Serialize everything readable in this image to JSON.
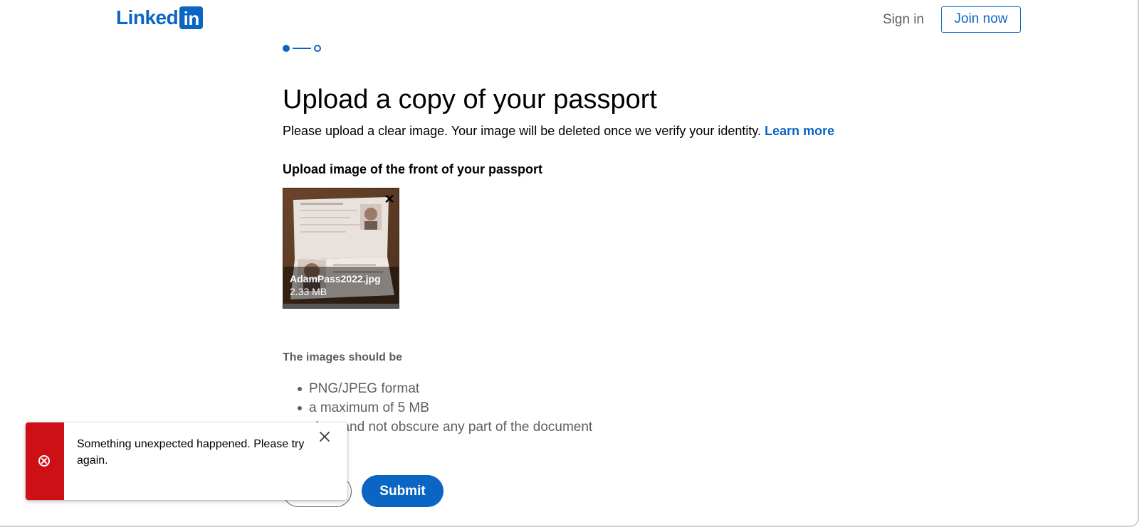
{
  "header": {
    "logo_text": "Linked",
    "logo_box_text": "in",
    "sign_in_label": "Sign in",
    "join_now_label": "Join now"
  },
  "stepper": {
    "current_step": 1,
    "total_steps": 2
  },
  "main": {
    "title": "Upload a copy of your passport",
    "subtitle": "Please upload a clear image. Your image will be deleted once we verify your identity.",
    "learn_more_label": "Learn more",
    "upload_label": "Upload image of the front of your passport",
    "file": {
      "name": "AdamPass2022.jpg",
      "size": "2.33 MB"
    },
    "requirements_heading": "The images should be",
    "requirements": [
      "PNG/JPEG format",
      "a maximum of 5 MB",
      "clear and not obscure any part of the document"
    ],
    "submit_label": "Submit"
  },
  "toast": {
    "message": "Something unexpected happened. Please try again."
  },
  "colors": {
    "brand": "#0a66c2",
    "error": "#cc1016",
    "muted_text": "#5e5e5e"
  }
}
